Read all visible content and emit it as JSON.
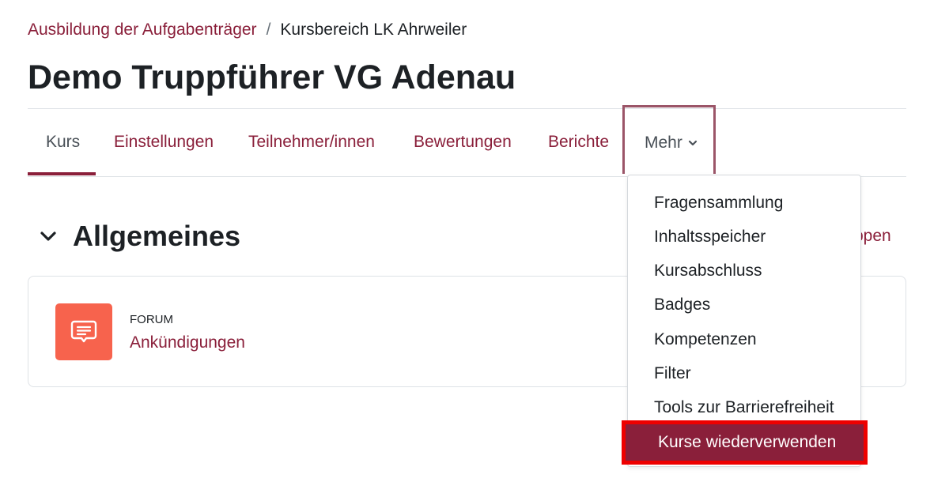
{
  "breadcrumb": {
    "parent": "Ausbildung der Aufgabenträger",
    "separator": "/",
    "current": "Kursbereich LK Ahrweiler"
  },
  "page": {
    "title": "Demo Truppführer VG Adenau"
  },
  "nav": {
    "tabs": [
      {
        "label": "Kurs",
        "active": true
      },
      {
        "label": "Einstellungen"
      },
      {
        "label": "Teilnehmer/innen"
      },
      {
        "label": "Bewertungen"
      },
      {
        "label": "Berichte"
      }
    ],
    "more": {
      "label": "Mehr",
      "icon": "chevron-down-icon"
    }
  },
  "section": {
    "title": "Allgemeines",
    "collapse_icon": "chevron-down-icon",
    "partial_link_text": "ppen"
  },
  "activity": {
    "type": "FORUM",
    "name": "Ankündigungen",
    "icon": "forum-icon",
    "icon_color": "#f7634d"
  },
  "dropdown": {
    "items": [
      {
        "label": "Fragensammlung"
      },
      {
        "label": "Inhaltsspeicher"
      },
      {
        "label": "Kursabschluss"
      },
      {
        "label": "Badges"
      },
      {
        "label": "Kompetenzen"
      },
      {
        "label": "Filter"
      },
      {
        "label": "Tools zur Barrierefreiheit"
      },
      {
        "label": "Kurse wiederverwenden",
        "highlighted": true
      }
    ]
  },
  "colors": {
    "brand": "#8a1f3a",
    "highlight_border": "#ee0000",
    "text": "#1d2125",
    "muted": "#495057"
  }
}
